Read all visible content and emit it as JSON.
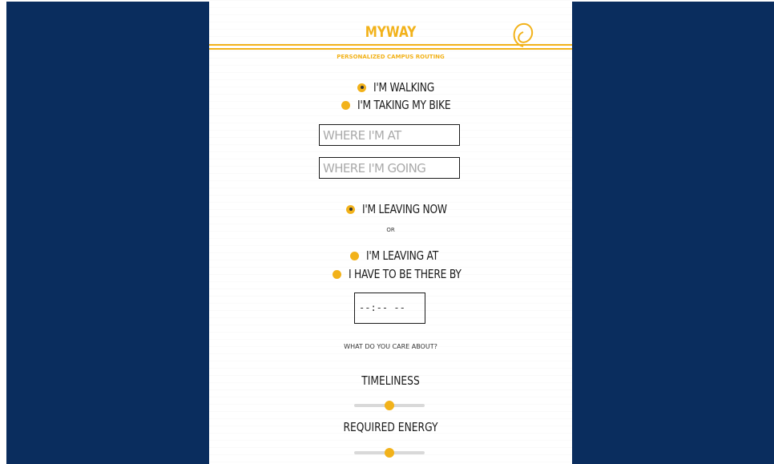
{
  "app": {
    "title": "MYWAY",
    "subtitle": "PERSONALIZED CAMPUS ROUTING"
  },
  "colors": {
    "accent": "#f2b21a",
    "side_panels": "#0a2d5e",
    "text": "#1a1a1a"
  },
  "mode": {
    "options": [
      {
        "label": "I'M WALKING",
        "selected": true
      },
      {
        "label": "I'M TAKING MY BIKE",
        "selected": false
      }
    ]
  },
  "route": {
    "origin_placeholder": "WHERE I'M AT",
    "destination_placeholder": "WHERE I'M GOING"
  },
  "departure": {
    "now_label": "I'M LEAVING NOW",
    "now_selected": true,
    "or_label": "OR",
    "options": [
      {
        "label": "I'M LEAVING AT",
        "selected": false
      },
      {
        "label": "I HAVE TO BE THERE BY",
        "selected": false
      }
    ],
    "time_value": "--:-- --"
  },
  "preferences": {
    "prompt": "WHAT DO YOU CARE ABOUT?",
    "sliders": [
      {
        "label": "TIMELINESS",
        "value": 0.5
      },
      {
        "label": "REQUIRED ENERGY",
        "value": 0.5
      }
    ]
  }
}
